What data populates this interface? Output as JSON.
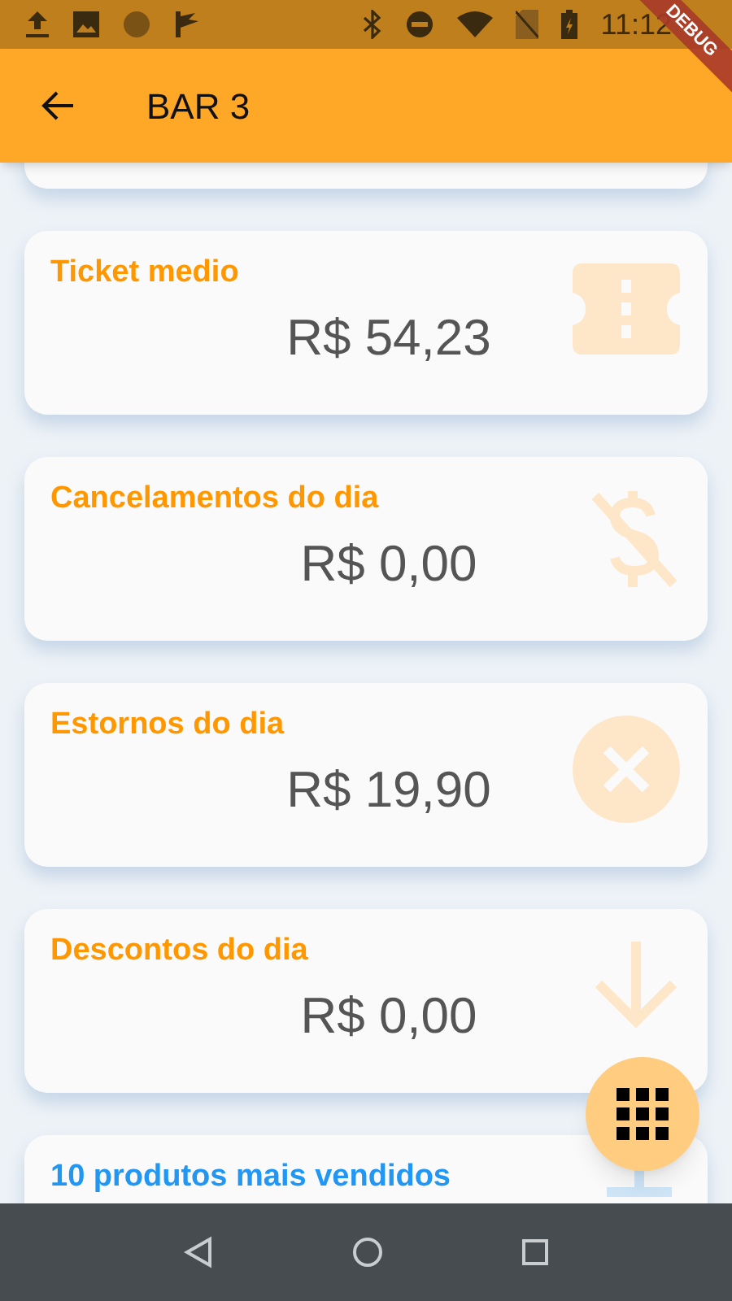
{
  "status_bar": {
    "time": "11:12"
  },
  "debug_banner": "DEBUG",
  "app_bar": {
    "title": "BAR 3"
  },
  "cards": [
    {
      "kind": "partial"
    },
    {
      "kind": "ticket",
      "title": "Ticket medio",
      "value": "R$ 54,23",
      "color": "#ff9800"
    },
    {
      "kind": "money-off",
      "title": "Cancelamentos do dia",
      "value": "R$ 0,00",
      "color": "#ff9800"
    },
    {
      "kind": "cancel",
      "title": "Estornos do dia",
      "value": "R$ 19,90",
      "color": "#ff9800"
    },
    {
      "kind": "arrow-down",
      "title": "Descontos do dia",
      "value": "R$ 0,00",
      "color": "#ff9800"
    },
    {
      "kind": "stand",
      "title": "10 produtos mais vendidos",
      "color": "#2196f3"
    }
  ]
}
